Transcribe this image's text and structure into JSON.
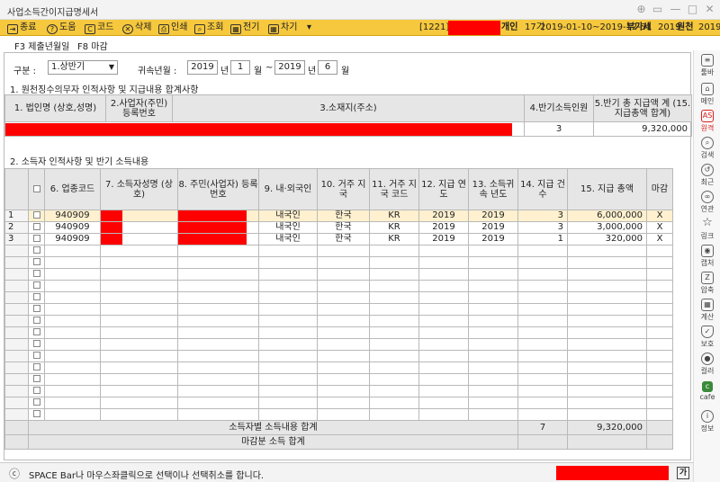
{
  "window": {
    "title": "사업소득간이지급명세서"
  },
  "toolbar": {
    "buttons": [
      {
        "label": "종료",
        "icon": "exit-icon"
      },
      {
        "label": "도움",
        "icon": "help-icon"
      },
      {
        "label": "코드",
        "icon": "code-icon"
      },
      {
        "label": "삭제",
        "icon": "delete-icon"
      },
      {
        "label": "인쇄",
        "icon": "print-icon"
      },
      {
        "label": "조회",
        "icon": "search-icon"
      },
      {
        "label": "전기",
        "icon": "calendar-icon"
      },
      {
        "label": "차기",
        "icon": "calendar-icon"
      }
    ],
    "company_code": "[1221]",
    "entity_type": "개인",
    "period_label": "17기",
    "period_range": "2019-01-10~2019-12-31",
    "vat_label": "부가세",
    "vat_year": "2019",
    "withholding_label": "원천",
    "withholding_year": "2019"
  },
  "fkeys": {
    "f3": "F3 제출년월일",
    "f8": "F8 마감"
  },
  "filter": {
    "category_label": "구분 :",
    "category_value": "1.상반기",
    "period_label": "귀속년월 :",
    "from_year": "2019",
    "year_unit1": "년",
    "from_month": "1",
    "month_unit1": "월",
    "tilde": "~",
    "to_year": "2019",
    "year_unit2": "년",
    "to_month": "6",
    "month_unit2": "월"
  },
  "section1": {
    "title": "1. 원천징수의무자 인적사항 및 지급내용 합계사항",
    "headers": [
      "1. 법인명 (상호,성명)",
      "2.사업자(주민) 등록번호",
      "3.소재지(주소)",
      "4.반기소득인원",
      "5.반기 총 지급액 계 (15.지급총액 합계)"
    ],
    "count": "3",
    "total": "9,320,000"
  },
  "section2": {
    "title": "2. 소득자 인적사항 및 반기 소득내용",
    "headers": [
      "6. 업종코드",
      "7. 소득자성명 (상호)",
      "8. 주민(사업자) 등록번호",
      "9. 내·외국인",
      "10. 거주 지국",
      "11. 거주 지국 코드",
      "12. 지급 연도",
      "13. 소득귀속 년도",
      "14. 지급 건수",
      "15. 지급 총액",
      "마감"
    ],
    "rows": [
      {
        "no": "1",
        "code": "940909",
        "foreign": "내국인",
        "country": "한국",
        "country_code": "KR",
        "pay_year": "2019",
        "income_year": "2019",
        "count": "3",
        "amount": "6,000,000",
        "closed": "X"
      },
      {
        "no": "2",
        "code": "940909",
        "foreign": "내국인",
        "country": "한국",
        "country_code": "KR",
        "pay_year": "2019",
        "income_year": "2019",
        "count": "3",
        "amount": "3,000,000",
        "closed": "X"
      },
      {
        "no": "3",
        "code": "940909",
        "foreign": "내국인",
        "country": "한국",
        "country_code": "KR",
        "pay_year": "2019",
        "income_year": "2019",
        "count": "1",
        "amount": "320,000",
        "closed": "X"
      }
    ],
    "sum_label": "소득자별 소득내용 합계",
    "sum_count": "7",
    "sum_amount": "9,320,000",
    "closed_sum_label": "마감분 소득 합계"
  },
  "status": {
    "message": "SPACE Bar나 마우스좌클릭으로 선택이나 선택취소를 합니다.",
    "ime": "가"
  },
  "sidebar": {
    "items": [
      {
        "label": "툴바",
        "icon": "menu-icon"
      },
      {
        "label": "메인",
        "icon": "home-icon"
      },
      {
        "label": "원격",
        "icon": "remote-icon",
        "badge": "AS"
      },
      {
        "label": "검색",
        "icon": "search-icon"
      },
      {
        "label": "최근",
        "icon": "history-icon"
      },
      {
        "label": "연관",
        "icon": "link-icon"
      },
      {
        "label": "링크",
        "icon": "star-icon"
      },
      {
        "label": "캡처",
        "icon": "camera-icon"
      },
      {
        "label": "압축",
        "icon": "zip-icon"
      },
      {
        "label": "계산",
        "icon": "calculator-icon"
      },
      {
        "label": "보호",
        "icon": "shield-icon"
      },
      {
        "label": "컬러",
        "icon": "palette-icon"
      },
      {
        "label": "cafe",
        "icon": "cafe-icon"
      },
      {
        "label": "정보",
        "icon": "info-icon"
      }
    ]
  },
  "colors": {
    "toolbar_bg": "#f6c83d",
    "redaction": "#ff0000",
    "selected_row": "#fff1cf",
    "active_sidebar": "#dd2222"
  }
}
